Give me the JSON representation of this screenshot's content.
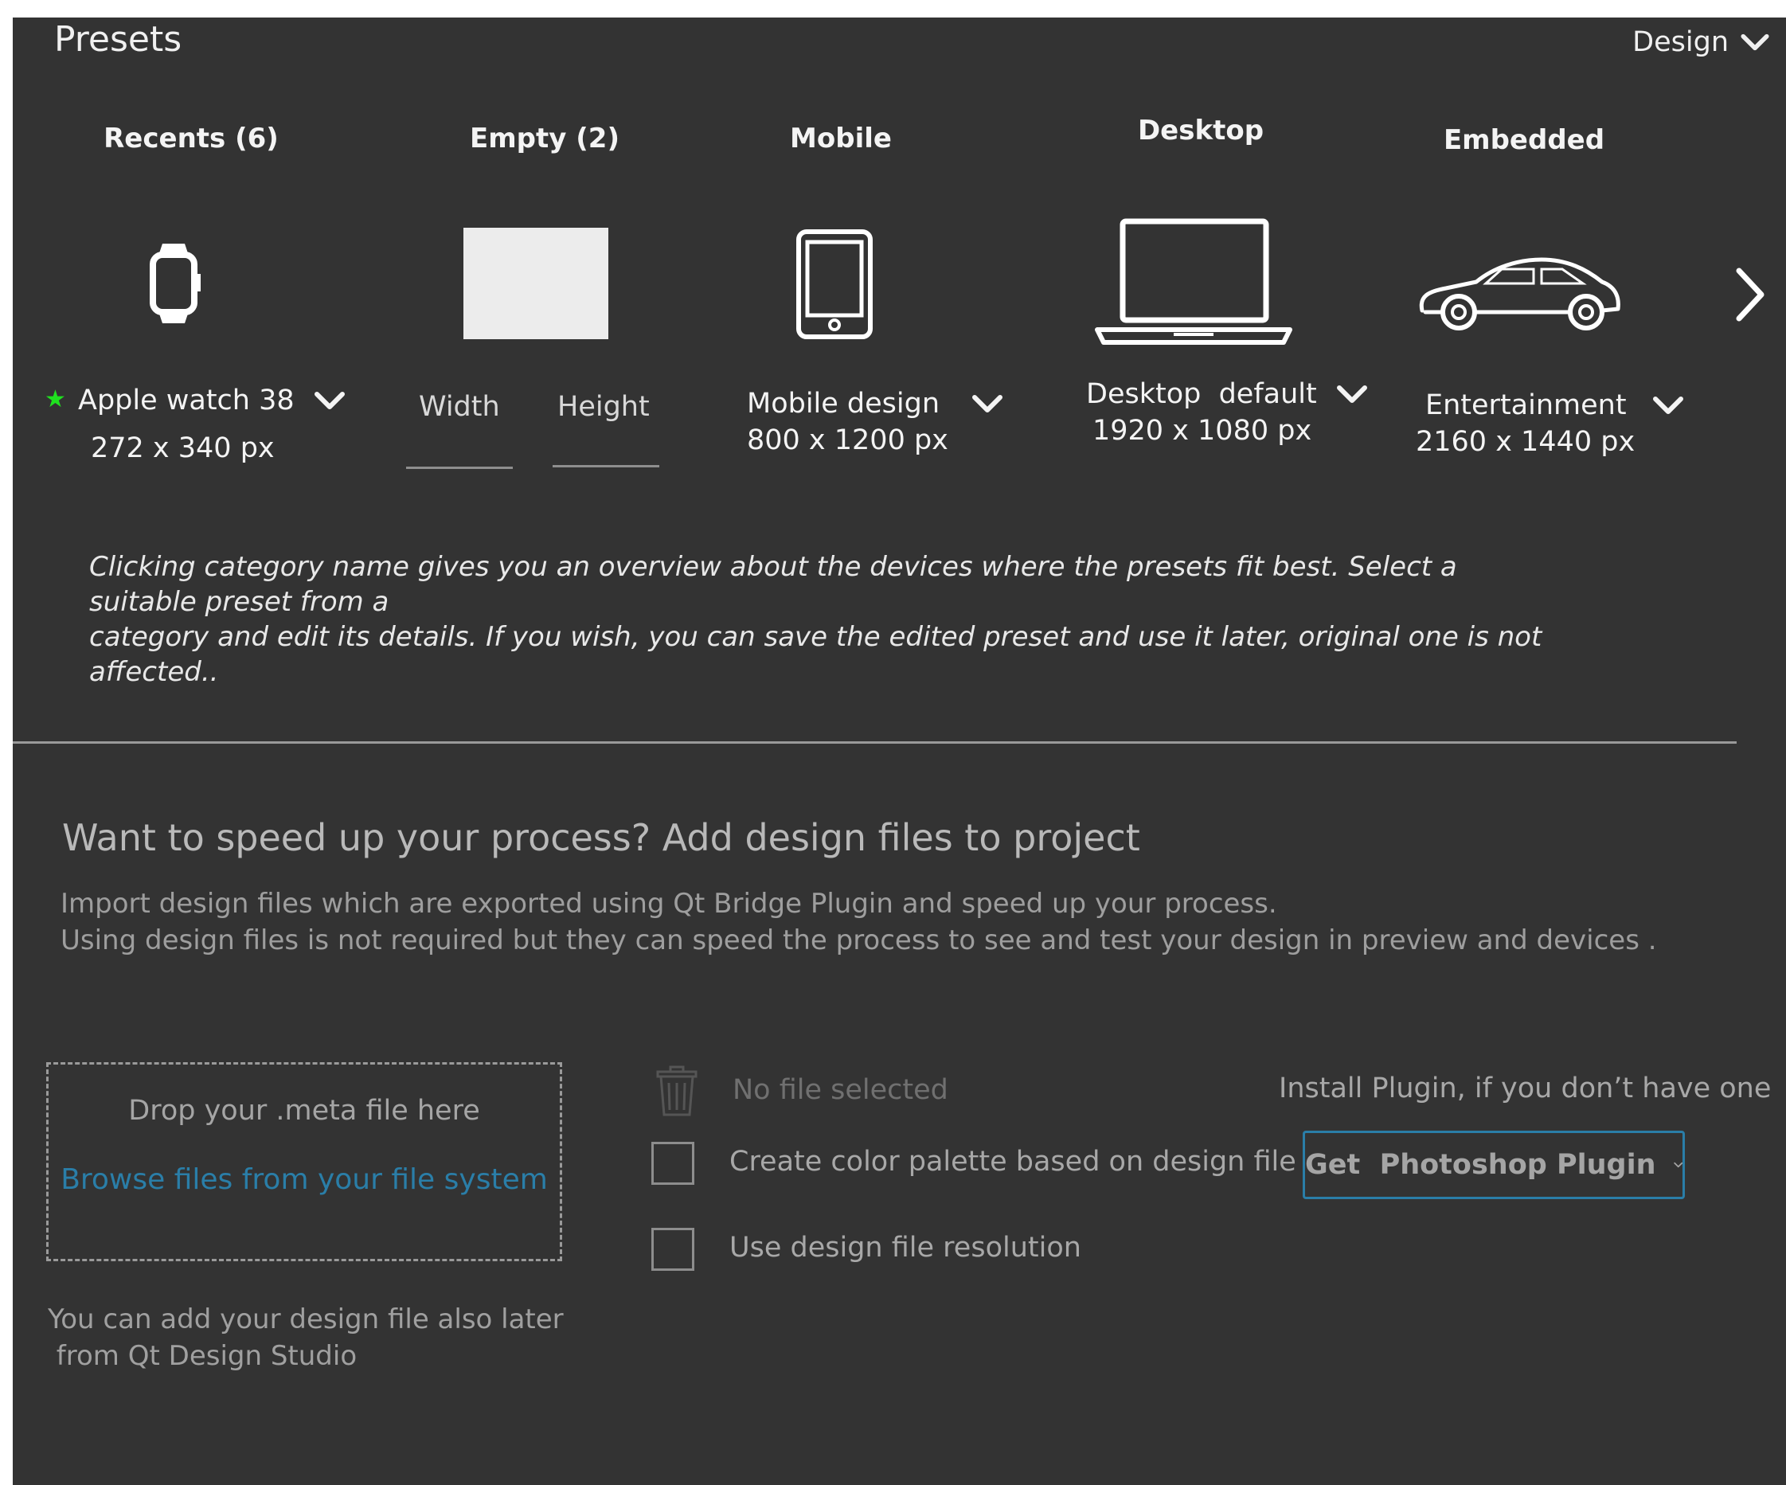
{
  "header": {
    "title": "Presets",
    "mode_label": "Design"
  },
  "categories": [
    {
      "label": "Recents (6)",
      "icon": "watch-icon",
      "preset": "Apple watch 38",
      "size": "272 x 340 px",
      "favorite": true
    },
    {
      "label": "Empty (2)",
      "icon": "blank-canvas-icon",
      "width_placeholder": "Width",
      "height_placeholder": "Height"
    },
    {
      "label": "Mobile",
      "icon": "tablet-icon",
      "preset": "Mobile design",
      "size": "800 x 1200 px"
    },
    {
      "label": "Desktop",
      "icon": "laptop-icon",
      "preset": "Desktop  default",
      "size": "1920 x 1080 px"
    },
    {
      "label": "Embedded",
      "icon": "car-icon",
      "preset": "Entertainment",
      "size": "2160 x 1440 px"
    }
  ],
  "hint": {
    "line1": "Clicking  category name gives you an overview about the devices where the presets fit best. Select a suitable preset from a",
    "line2": "category and edit its details. If you wish, you can save the edited preset and use it later, original one is not affected.."
  },
  "design_files": {
    "heading": "Want to speed up your process?  Add design files to project",
    "desc_line1": "Import design files which are exported using Qt Bridge Plugin and speed up your process.",
    "desc_line2": "Using design files is not required but they can speed the process to see and test your design in preview and devices .",
    "drop_label": "Drop your .meta file here",
    "browse_link": "Browse files from your file system",
    "later_line1": "You can add your design file also later",
    "later_line2": " from Qt Design Studio",
    "no_file": "No file selected",
    "checkbox_palette": "Create color palette  based on design file",
    "checkbox_resolution": "Use design file resolution",
    "install_text": "Install Plugin, if you don’t have one",
    "plugin_button": "Get  Photoshop Plugin"
  },
  "colors": {
    "background": "#333333",
    "accent": "#2a7ea8",
    "favorite": "#1fe21f"
  }
}
